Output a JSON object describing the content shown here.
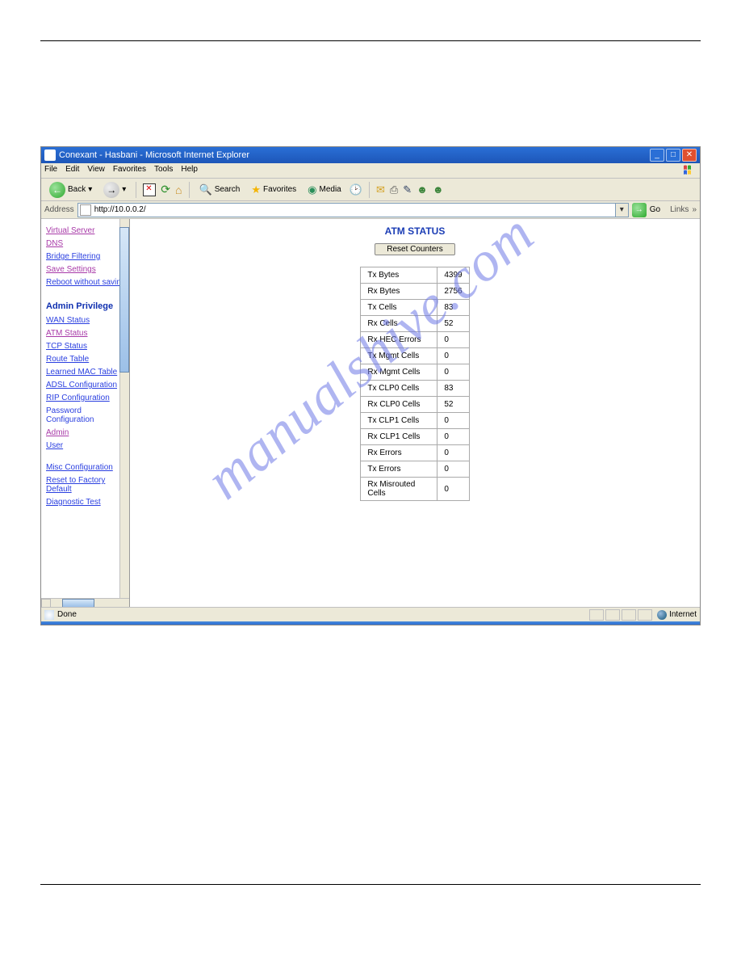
{
  "window_title": "Conexant - Hasbani - Microsoft Internet Explorer",
  "menubar": {
    "items": [
      "File",
      "Edit",
      "View",
      "Favorites",
      "Tools",
      "Help"
    ]
  },
  "toolbar": {
    "back": "Back",
    "search": "Search",
    "favorites": "Favorites",
    "media": "Media"
  },
  "addressbar": {
    "label": "Address",
    "url": "http://10.0.0.2/",
    "go": "Go",
    "links": "Links"
  },
  "sidebar": {
    "top_links": [
      {
        "label": "Virtual Server",
        "visited": true
      },
      {
        "label": "DNS",
        "visited": true
      },
      {
        "label": "Bridge Filtering",
        "visited": false
      },
      {
        "label": "Save Settings",
        "visited": true
      },
      {
        "label": "Reboot without saving",
        "visited": false
      }
    ],
    "section_title": "Admin Privilege",
    "admin_links": [
      {
        "label": "WAN Status"
      },
      {
        "label": "ATM Status",
        "visited": true
      },
      {
        "label": "TCP Status"
      },
      {
        "label": "Route Table"
      },
      {
        "label": "Learned MAC Table"
      },
      {
        "label": "ADSL Configuration"
      },
      {
        "label": "RIP Configuration"
      }
    ],
    "password_label": "Password Configuration",
    "password_sub": [
      "Admin",
      "User"
    ],
    "misc_links": [
      {
        "label": "Misc Configuration"
      },
      {
        "label": "Reset to Factory Default"
      },
      {
        "label": "Diagnostic Test"
      }
    ]
  },
  "main": {
    "title": "ATM STATUS",
    "reset_btn": "Reset Counters",
    "rows": [
      {
        "label": "Tx Bytes",
        "value": "4399"
      },
      {
        "label": "Rx Bytes",
        "value": "2756"
      },
      {
        "label": "Tx Cells",
        "value": "83"
      },
      {
        "label": "Rx Cells",
        "value": "52"
      },
      {
        "label": "Rx HEC Errors",
        "value": "0"
      },
      {
        "label": "Tx Mgmt Cells",
        "value": "0"
      },
      {
        "label": "Rx Mgmt Cells",
        "value": "0"
      },
      {
        "label": "Tx CLP0 Cells",
        "value": "83"
      },
      {
        "label": "Rx CLP0 Cells",
        "value": "52"
      },
      {
        "label": "Tx CLP1 Cells",
        "value": "0"
      },
      {
        "label": "Rx CLP1 Cells",
        "value": "0"
      },
      {
        "label": "Rx Errors",
        "value": "0"
      },
      {
        "label": "Tx Errors",
        "value": "0"
      },
      {
        "label": "Rx Misrouted Cells",
        "value": "0"
      }
    ]
  },
  "statusbar": {
    "done": "Done",
    "zone": "Internet"
  },
  "watermark": "manualshive.com"
}
